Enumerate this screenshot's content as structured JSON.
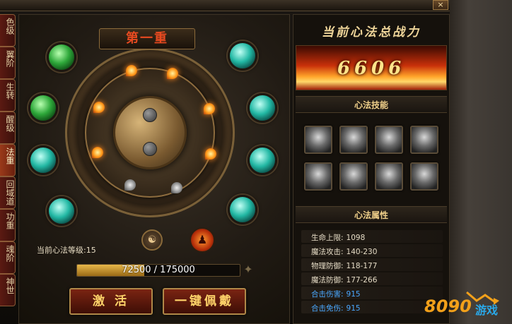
{
  "left_tabs": [
    {
      "label": "色级",
      "active": false
    },
    {
      "label": "翼阶",
      "active": false
    },
    {
      "label": "生转",
      "active": false
    },
    {
      "label": "醒级",
      "active": false
    },
    {
      "label": "法重",
      "active": true
    },
    {
      "label": "回域道",
      "active": false
    },
    {
      "label": "功重",
      "active": false
    },
    {
      "label": "魂阶",
      "active": false
    },
    {
      "label": "神世",
      "active": false
    }
  ],
  "main": {
    "title": "第一重",
    "level_label": "当前心法等级:15",
    "progress": {
      "current": 72500,
      "max": 175000,
      "text": "72500 / 175000"
    },
    "activate_button": "激 活",
    "equip_button": "一键佩戴",
    "fire_nodes_lit": 6,
    "fire_nodes_total": 9
  },
  "right": {
    "power_title": "当前心法总战力",
    "power_value": "6606",
    "skills_header": "心法技能",
    "attributes_header": "心法属性",
    "stats": [
      {
        "label": "生命上限:",
        "value": "1098",
        "color": "white"
      },
      {
        "label": "魔法攻击:",
        "value": "140-230",
        "color": "white"
      },
      {
        "label": "物理防御:",
        "value": "118-177",
        "color": "white"
      },
      {
        "label": "魔法防御:",
        "value": "177-266",
        "color": "white"
      },
      {
        "label": "合击伤害:",
        "value": "915",
        "color": "blue"
      },
      {
        "label": "合击免伤:",
        "value": "915",
        "color": "blue"
      }
    ]
  },
  "watermark": {
    "number": "8090",
    "text": "游戏"
  },
  "colors": {
    "accent_gold": "#f0d08a",
    "fire": "#ff8a20",
    "stat_blue": "#4aa8ff",
    "button_red": "#7a2412"
  }
}
